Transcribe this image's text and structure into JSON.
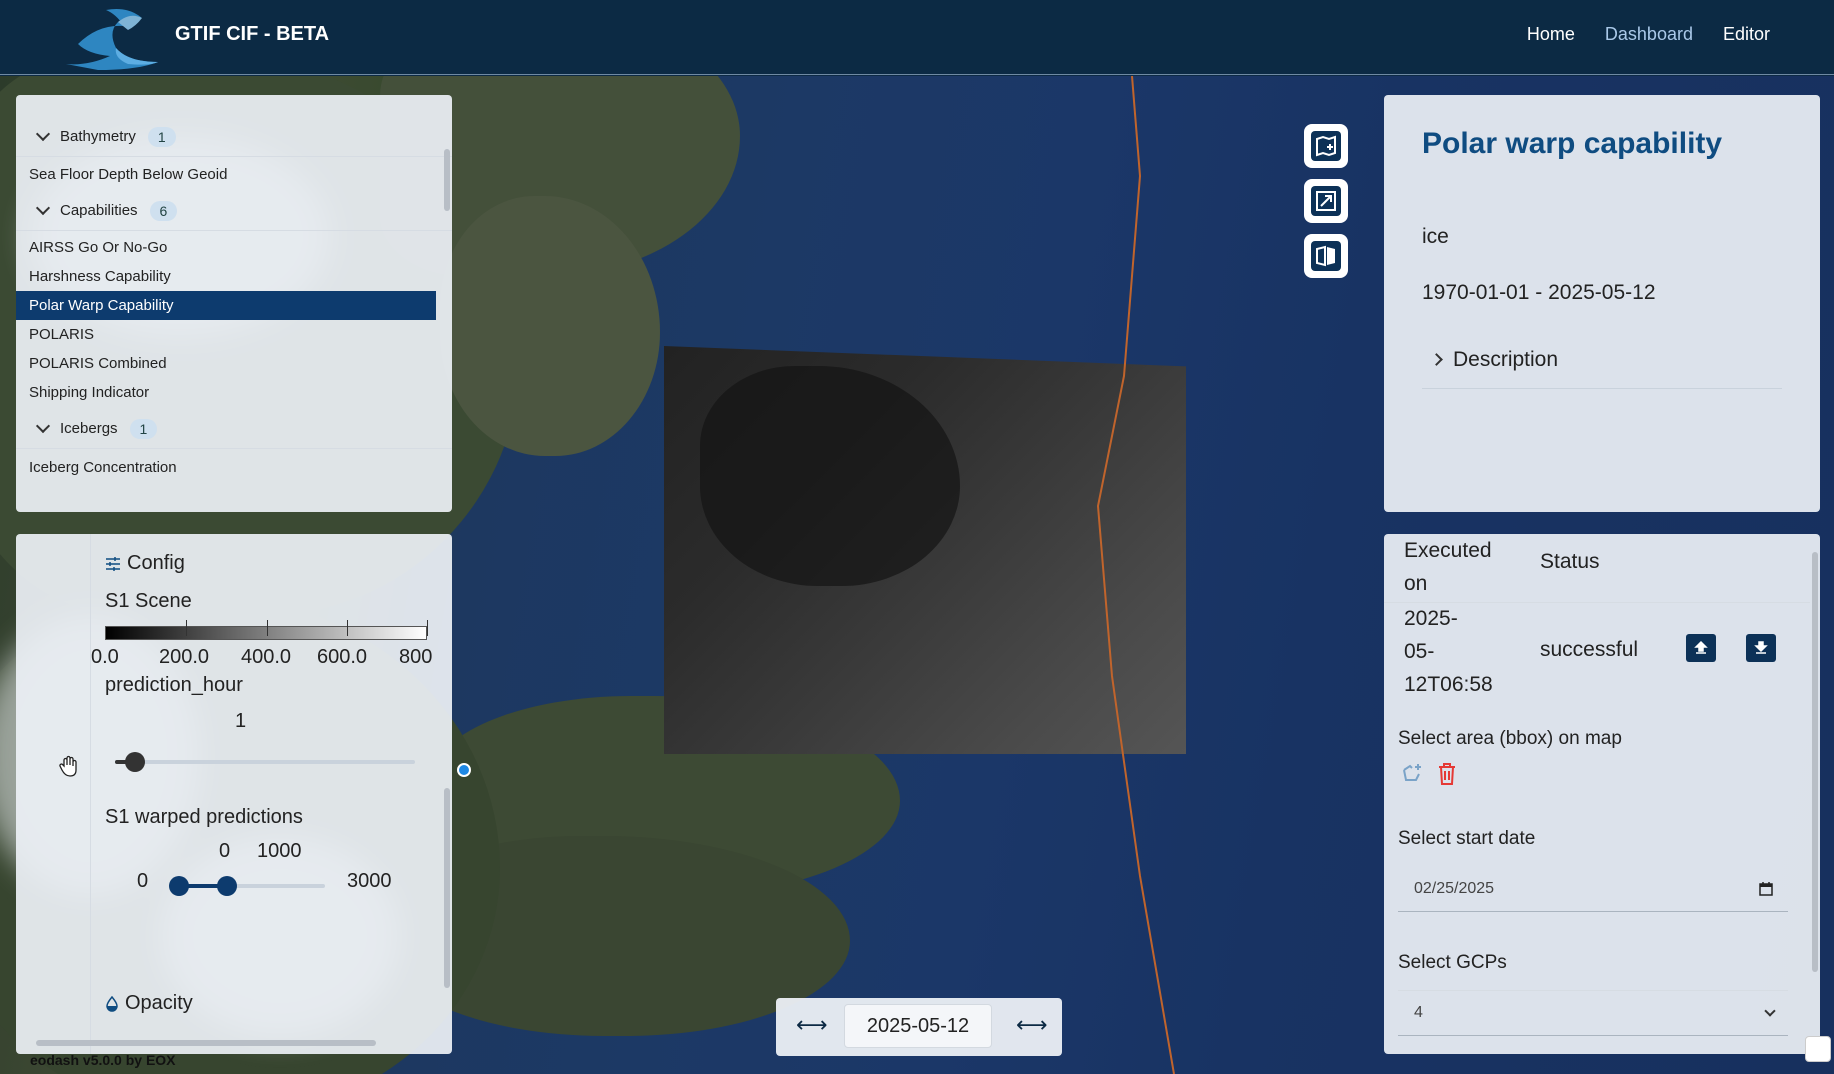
{
  "header": {
    "title": "GTIF CIF - BETA",
    "nav": [
      {
        "label": "Home",
        "active": false
      },
      {
        "label": "Dashboard",
        "active": true
      },
      {
        "label": "Editor",
        "active": false
      }
    ]
  },
  "layers": {
    "groups": [
      {
        "name": "Bathymetry",
        "count": "1",
        "items": [
          "Sea Floor Depth Below Geoid"
        ]
      },
      {
        "name": "Capabilities",
        "count": "6",
        "items": [
          "AIRSS Go Or No-Go",
          "Harshness Capability",
          "Polar Warp Capability",
          "POLARIS",
          "POLARIS Combined",
          "Shipping Indicator"
        ]
      },
      {
        "name": "Icebergs",
        "count": "1",
        "items": [
          "Iceberg Concentration"
        ]
      }
    ],
    "selected": "Polar Warp Capability"
  },
  "config": {
    "heading": "Config",
    "scene_label": "S1 Scene",
    "colorbar_ticks": [
      "0.0",
      "200.0",
      "400.0",
      "600.0",
      "800"
    ],
    "prediction_hour_label": "prediction_hour",
    "prediction_hour_value": "1",
    "warped_label": "S1 warped predictions",
    "range_low_value": "0",
    "range_high_value": "1000",
    "range_min": "0",
    "range_max": "3000",
    "opacity_label": "Opacity"
  },
  "info": {
    "title": "Polar warp capability",
    "tag": "ice",
    "date_range": "1970-01-01 - 2025-05-12",
    "description_label": "Description"
  },
  "process": {
    "col_executed": "Executed on",
    "col_status": "Status",
    "row_date_1": "2025-",
    "row_date_2": "05-",
    "row_date_3": "12T06:58",
    "row_status": "successful",
    "bbox_label": "Select area (bbox) on map",
    "start_date_label": "Select start date",
    "start_date_value": "02/25/2025",
    "gcps_label": "Select GCPs",
    "gcps_value": "4"
  },
  "timeline": {
    "date": "2025-05-12"
  },
  "footer": {
    "version": "eodash v5.0.0 by EOX"
  },
  "colors": {
    "header_bg": "#0c2a44",
    "accent": "#0d3b6e",
    "title_blue": "#0f4c81",
    "delete_red": "#e53935"
  }
}
